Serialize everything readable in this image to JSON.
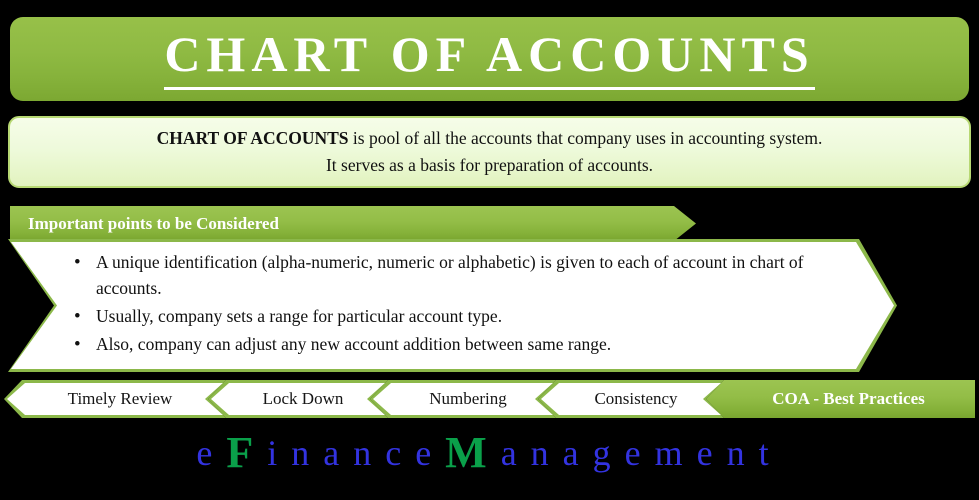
{
  "title": {
    "text": "CHART OF ACCOUNTS"
  },
  "description": {
    "bold_lead": "CHART OF ACCOUNTS",
    "line_1_rest": " is pool of all the accounts that company uses in accounting system.",
    "line_2": "It serves as a basis for preparation of accounts."
  },
  "points_banner": {
    "label": "Important points to be Considered"
  },
  "bullets": [
    "A unique identification (alpha-numeric, numeric or alphabetic) is given to each of account in chart of accounts.",
    "Usually, company sets a range for particular account type.",
    "Also, company can adjust any new account addition between same range."
  ],
  "chevrons": [
    {
      "label": "Timely Review"
    },
    {
      "label": "Lock Down"
    },
    {
      "label": "Numbering"
    },
    {
      "label": "Consistency"
    },
    {
      "label": "COA - Best Practices"
    }
  ],
  "logo": {
    "parts": [
      {
        "text": "e",
        "style": "lower"
      },
      {
        "text": "F",
        "style": "cap"
      },
      {
        "text": "inance",
        "style": "lower"
      },
      {
        "text": "M",
        "style": "cap"
      },
      {
        "text": "anagement",
        "style": "lower"
      }
    ],
    "full_text": "eFinanceManagement"
  },
  "colors": {
    "background": "#000000",
    "green_primary": "#8cb84a",
    "green_dark": "#79a52f",
    "green_light_fill": "#eefadb",
    "green_border": "#b7d873",
    "logo_blue": "#3333e0",
    "logo_green": "#0aa04a",
    "white": "#ffffff",
    "text_dark": "#111111"
  }
}
